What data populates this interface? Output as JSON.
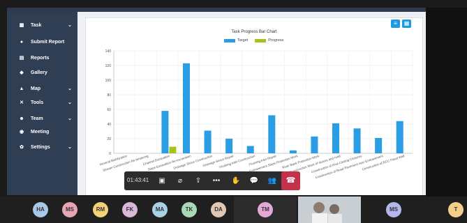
{
  "sidebar": {
    "items": [
      {
        "label": "Task",
        "icon": "task-icon",
        "chevron": true
      },
      {
        "label": "Submit Report",
        "icon": "submit-icon",
        "chevron": false
      },
      {
        "label": "Reports",
        "icon": "reports-icon",
        "chevron": false
      },
      {
        "label": "Gallery",
        "icon": "gallery-icon",
        "chevron": false
      },
      {
        "label": "Map",
        "icon": "map-icon",
        "chevron": true
      },
      {
        "label": "Tools",
        "icon": "tools-icon",
        "chevron": true
      },
      {
        "label": "Team",
        "icon": "team-icon",
        "chevron": true
      },
      {
        "label": "Meeting",
        "icon": "meeting-icon",
        "chevron": false
      },
      {
        "label": "Settings",
        "icon": "settings-icon",
        "chevron": true
      }
    ]
  },
  "chart_data": {
    "type": "bar",
    "title": "Task Progress Bar Chart",
    "ylim": [
      0,
      140
    ],
    "yticks": [
      0,
      20,
      40,
      60,
      80,
      100,
      120,
      140
    ],
    "categories": [
      "General Mobilization",
      "Stream Construction Re-tendering",
      "Channel Excavation",
      "Slope Excavation Re-excavation",
      "Drainage Sluice Construction",
      "Drainage Sluice Repair",
      "Flushing Inlet Construction",
      "Flushing Inlet Repair",
      "Embankment Slope Protection Work",
      "River Bank Protection Work",
      "Construction Work of sluices and road",
      "Construction of Khal Closing Closures",
      "Construction of Road Pavement over Embankment",
      "Construction of RCC Flood Wall"
    ],
    "series": [
      {
        "name": "Target",
        "color": "#2a9de4",
        "values": [
          0,
          0,
          58,
          123,
          31,
          20,
          10,
          52,
          4,
          23,
          41,
          34,
          21,
          44
        ]
      },
      {
        "name": "Progress",
        "color": "#a5c41a",
        "values": [
          0,
          0,
          9,
          0,
          0,
          0,
          0,
          0,
          0,
          0,
          0,
          0,
          0,
          0
        ]
      }
    ]
  },
  "call": {
    "elapsed": "01:43:41",
    "controls": [
      "camera-off-icon",
      "mic-off-icon",
      "share-icon",
      "more-icon",
      "raise-hand-icon",
      "chat-icon",
      "people-icon"
    ]
  },
  "participants": [
    {
      "initials": "HA",
      "color": "#a9c7e8"
    },
    {
      "initials": "MS",
      "color": "#e8a6b4"
    },
    {
      "initials": "RM",
      "color": "#f1d27a"
    },
    {
      "initials": "FK",
      "color": "#d9b8d9"
    },
    {
      "initials": "MA",
      "color": "#a8d0e6"
    },
    {
      "initials": "TK",
      "color": "#a9d8b8"
    },
    {
      "initials": "DA",
      "color": "#e3c7b0"
    },
    {
      "initials": "TM",
      "color": "#e2a9d6"
    },
    {
      "initials": "MS",
      "color": "#b3b8ec"
    },
    {
      "initials": "T",
      "color": "#f3d08a"
    }
  ]
}
